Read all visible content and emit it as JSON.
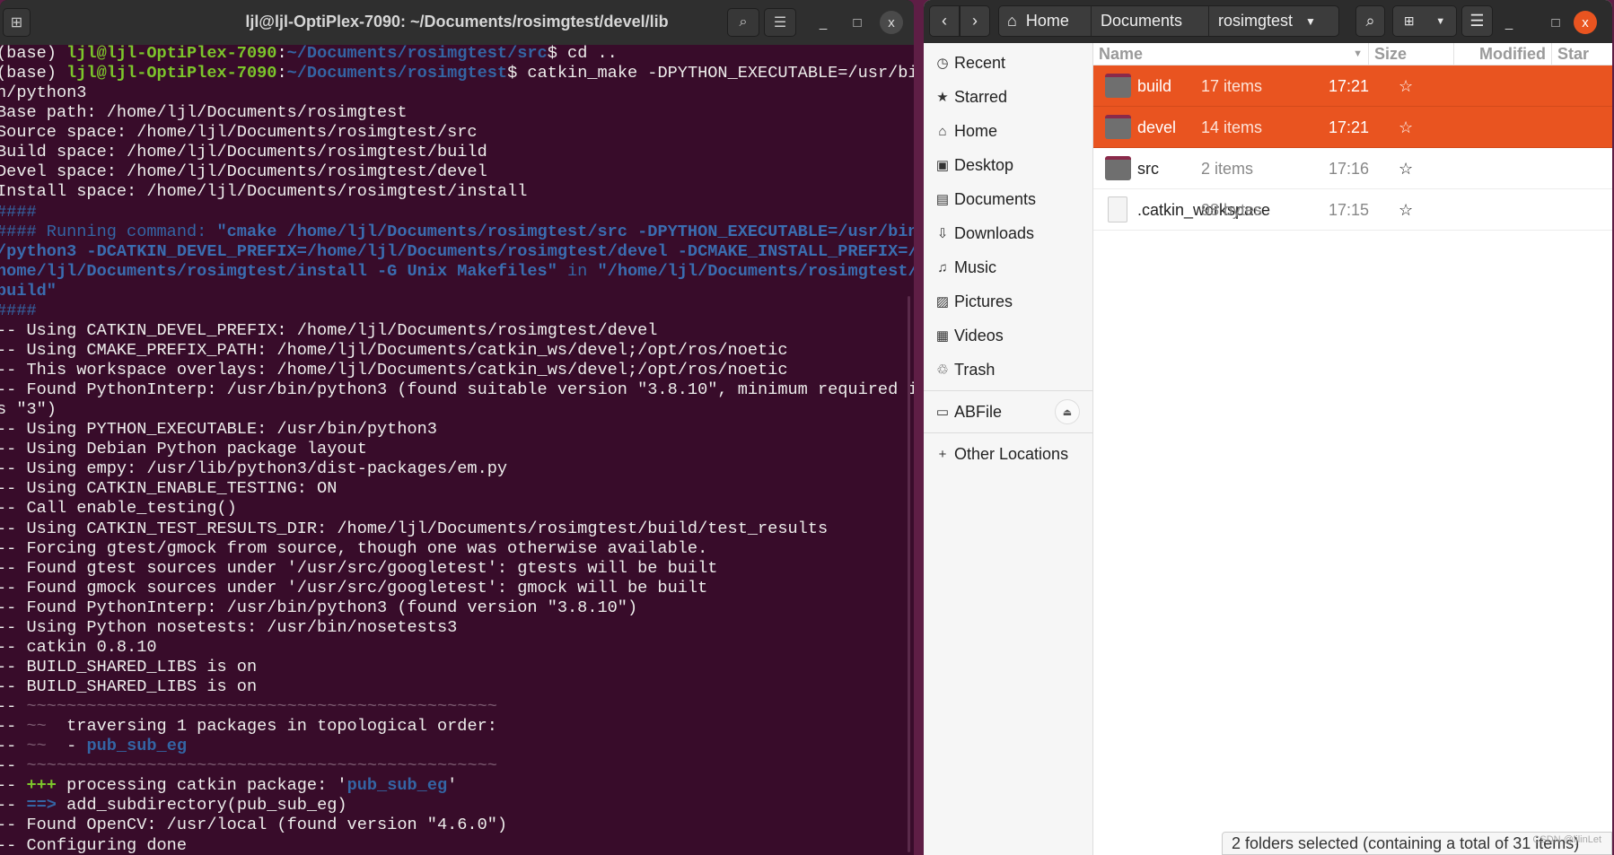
{
  "terminal": {
    "title": "ljl@ljl-OptiPlex-7090: ~/Documents/rosimgtest/devel/lib",
    "icons": {
      "new_tab": "new-tab-icon",
      "search": "search-icon",
      "menu": "hamburger-icon"
    },
    "lines": [
      [
        [
          "",
          "(base) "
        ],
        [
          "g",
          "ljl@ljl-OptiPlex-7090"
        ],
        [
          "",
          ":"
        ],
        [
          "b",
          "~/Documents/rosimgtest/src"
        ],
        [
          "",
          "$ cd .."
        ]
      ],
      [
        [
          "",
          "(base) "
        ],
        [
          "g",
          "ljl@ljl-OptiPlex-7090"
        ],
        [
          "",
          ":"
        ],
        [
          "b",
          "~/Documents/rosimgtest"
        ],
        [
          "",
          "$ catkin_make -DPYTHON_EXECUTABLE=/usr/bi"
        ]
      ],
      [
        [
          "",
          "n/python3"
        ]
      ],
      [
        [
          "",
          "Base path: /home/ljl/Documents/rosimgtest"
        ]
      ],
      [
        [
          "",
          "Source space: /home/ljl/Documents/rosimgtest/src"
        ]
      ],
      [
        [
          "",
          "Build space: /home/ljl/Documents/rosimgtest/build"
        ]
      ],
      [
        [
          "",
          "Devel space: /home/ljl/Documents/rosimgtest/devel"
        ]
      ],
      [
        [
          "",
          "Install space: /home/ljl/Documents/rosimgtest/install"
        ]
      ],
      [
        [
          "d",
          "####"
        ]
      ],
      [
        [
          "d",
          "#### Running command: "
        ],
        [
          "bb",
          "\"cmake /home/ljl/Documents/rosimgtest/src -DPYTHON_EXECUTABLE=/usr/bin"
        ]
      ],
      [
        [
          "bb",
          "/python3 -DCATKIN_DEVEL_PREFIX=/home/ljl/Documents/rosimgtest/devel -DCMAKE_INSTALL_PREFIX=/"
        ]
      ],
      [
        [
          "bb",
          "home/ljl/Documents/rosimgtest/install -G Unix Makefiles\""
        ],
        [
          "d",
          " in "
        ],
        [
          "bb",
          "\"/home/ljl/Documents/rosimgtest/"
        ]
      ],
      [
        [
          "bb",
          "build\""
        ]
      ],
      [
        [
          "d",
          "####"
        ]
      ],
      [
        [
          "",
          "-- Using CATKIN_DEVEL_PREFIX: /home/ljl/Documents/rosimgtest/devel"
        ]
      ],
      [
        [
          "",
          "-- Using CMAKE_PREFIX_PATH: /home/ljl/Documents/catkin_ws/devel;/opt/ros/noetic"
        ]
      ],
      [
        [
          "",
          "-- This workspace overlays: /home/ljl/Documents/catkin_ws/devel;/opt/ros/noetic"
        ]
      ],
      [
        [
          "",
          "-- Found PythonInterp: /usr/bin/python3 (found suitable version \"3.8.10\", minimum required i"
        ]
      ],
      [
        [
          "",
          "s \"3\")"
        ]
      ],
      [
        [
          "",
          "-- Using PYTHON_EXECUTABLE: /usr/bin/python3"
        ]
      ],
      [
        [
          "",
          "-- Using Debian Python package layout"
        ]
      ],
      [
        [
          "",
          "-- Using empy: /usr/lib/python3/dist-packages/em.py"
        ]
      ],
      [
        [
          "",
          "-- Using CATKIN_ENABLE_TESTING: ON"
        ]
      ],
      [
        [
          "",
          "-- Call enable_testing()"
        ]
      ],
      [
        [
          "",
          "-- Using CATKIN_TEST_RESULTS_DIR: /home/ljl/Documents/rosimgtest/build/test_results"
        ]
      ],
      [
        [
          "",
          "-- Forcing gtest/gmock from source, though one was otherwise available."
        ]
      ],
      [
        [
          "",
          "-- Found gtest sources under '/usr/src/googletest': gtests will be built"
        ]
      ],
      [
        [
          "",
          "-- Found gmock sources under '/usr/src/googletest': gmock will be built"
        ]
      ],
      [
        [
          "",
          "-- Found PythonInterp: /usr/bin/python3 (found version \"3.8.10\")"
        ]
      ],
      [
        [
          "",
          "-- Using Python nosetests: /usr/bin/nosetests3"
        ]
      ],
      [
        [
          "",
          "-- catkin 0.8.10"
        ]
      ],
      [
        [
          "",
          "-- BUILD_SHARED_LIBS is on"
        ]
      ],
      [
        [
          "",
          "-- BUILD_SHARED_LIBS is on"
        ]
      ],
      [
        [
          "",
          "-- "
        ],
        [
          "t",
          "~~~~~~~~~~~~~~~~~~~~~~~~~~~~~~~~~~~~~~~~~~~~~~~"
        ]
      ],
      [
        [
          "",
          "-- "
        ],
        [
          "t",
          "~~"
        ],
        [
          "",
          "  traversing 1 packages in topological order:"
        ]
      ],
      [
        [
          "",
          "-- "
        ],
        [
          "t",
          "~~"
        ],
        [
          "",
          "  - "
        ],
        [
          "b",
          "pub_sub_eg"
        ]
      ],
      [
        [
          "",
          "-- "
        ],
        [
          "t",
          "~~~~~~~~~~~~~~~~~~~~~~~~~~~~~~~~~~~~~~~~~~~~~~~"
        ]
      ],
      [
        [
          "",
          "-- "
        ],
        [
          "g",
          "+++"
        ],
        [
          "",
          " processing catkin package: '"
        ],
        [
          "b",
          "pub_sub_eg"
        ],
        [
          "",
          "'"
        ]
      ],
      [
        [
          "",
          "-- "
        ],
        [
          "b",
          "==>"
        ],
        [
          "",
          " add_subdirectory(pub_sub_eg)"
        ]
      ],
      [
        [
          "",
          "-- Found OpenCV: /usr/local (found version \"4.6.0\")"
        ]
      ],
      [
        [
          "",
          "-- Configuring done"
        ]
      ]
    ]
  },
  "files": {
    "path": [
      "Home",
      "Documents",
      "rosimgtest"
    ],
    "sidebar": [
      "Recent",
      "Starred",
      "Home",
      "Desktop",
      "Documents",
      "Downloads",
      "Music",
      "Pictures",
      "Videos",
      "Trash"
    ],
    "sidebar_icons": [
      "clock-icon",
      "star-icon",
      "home-icon",
      "desktop-icon",
      "document-icon",
      "download-icon",
      "music-icon",
      "picture-icon",
      "video-icon",
      "trash-icon"
    ],
    "drive": "ABFile",
    "other": "Other Locations",
    "columns": {
      "name": "Name",
      "size": "Size",
      "modified": "Modified",
      "star": "Star"
    },
    "rows": [
      {
        "name": "build",
        "size": "17 items",
        "modified": "17:21",
        "selected": true,
        "type": "folder"
      },
      {
        "name": "devel",
        "size": "14 items",
        "modified": "17:21",
        "selected": true,
        "type": "folder"
      },
      {
        "name": "src",
        "size": "2 items",
        "modified": "17:16",
        "selected": false,
        "type": "folder"
      },
      {
        "name": ".catkin_workspace",
        "size": "98 bytes",
        "modified": "17:15",
        "selected": false,
        "type": "file"
      }
    ],
    "status": "2 folders selected (containing a total of 31 items)",
    "selection_color": "#e95420",
    "watermark": "CSDN @ljlinLet"
  }
}
